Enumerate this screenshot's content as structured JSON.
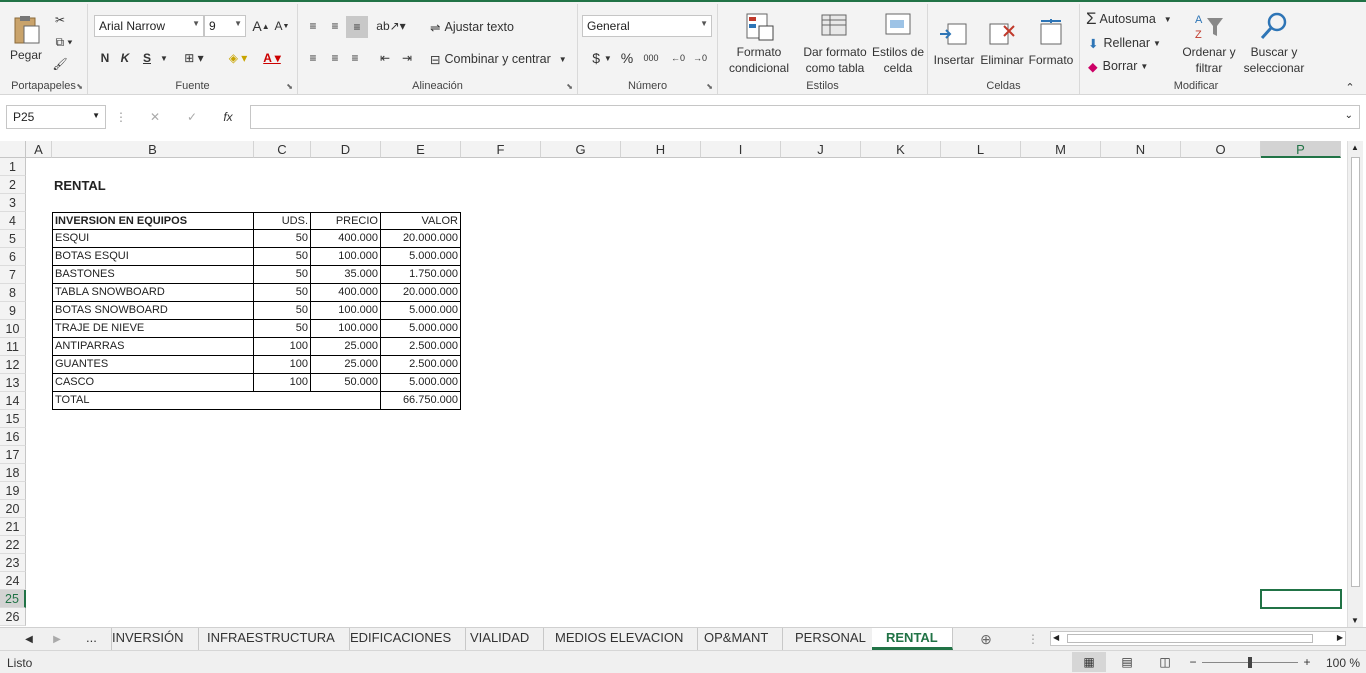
{
  "ribbon": {
    "portapapeles": {
      "label": "Portapapeles",
      "pegar": "Pegar"
    },
    "fuente": {
      "label": "Fuente",
      "font": "Arial Narrow",
      "size": "9",
      "bold": "N",
      "italic": "K",
      "underline": "S"
    },
    "alineacion": {
      "label": "Alineación",
      "wrap": "Ajustar texto",
      "merge": "Combinar y centrar"
    },
    "numero": {
      "label": "Número",
      "format": "General",
      "currency": "$",
      "percent": "%",
      "thousands": "000"
    },
    "estilos": {
      "label": "Estilos",
      "cond": "Formato condicional",
      "table": "Dar formato como tabla",
      "cellstyles": "Estilos de celda"
    },
    "celdas": {
      "label": "Celdas",
      "insert": "Insertar",
      "delete": "Eliminar",
      "format": "Formato"
    },
    "modificar": {
      "label": "Modificar",
      "autosum": "Autosuma",
      "fill": "Rellenar",
      "clear": "Borrar",
      "sort": "Ordenar y filtrar",
      "find": "Buscar y seleccionar"
    }
  },
  "formula_bar": {
    "name_box": "P25",
    "fx": "fx",
    "value": ""
  },
  "columns": [
    "A",
    "B",
    "C",
    "D",
    "E",
    "F",
    "G",
    "H",
    "I",
    "J",
    "K",
    "L",
    "M",
    "N",
    "O",
    "P"
  ],
  "rows": [
    "1",
    "2",
    "3",
    "4",
    "5",
    "6",
    "7",
    "8",
    "9",
    "10",
    "11",
    "12",
    "13",
    "14",
    "15",
    "16",
    "17",
    "18",
    "19",
    "20",
    "21",
    "22",
    "23",
    "24",
    "25",
    "26"
  ],
  "sheet": {
    "title": "RENTAL",
    "headers": [
      "INVERSION EN EQUIPOS",
      "UDS.",
      "PRECIO",
      "VALOR"
    ],
    "items": [
      [
        "ESQUI",
        "50",
        "400.000",
        "20.000.000"
      ],
      [
        "BOTAS ESQUI",
        "50",
        "100.000",
        "5.000.000"
      ],
      [
        "BASTONES",
        "50",
        "35.000",
        "1.750.000"
      ],
      [
        "TABLA SNOWBOARD",
        "50",
        "400.000",
        "20.000.000"
      ],
      [
        "BOTAS SNOWBOARD",
        "50",
        "100.000",
        "5.000.000"
      ],
      [
        "TRAJE DE NIEVE",
        "50",
        "100.000",
        "5.000.000"
      ],
      [
        "ANTIPARRAS",
        "100",
        "25.000",
        "2.500.000"
      ],
      [
        "GUANTES",
        "100",
        "25.000",
        "2.500.000"
      ],
      [
        "CASCO",
        "100",
        "50.000",
        "5.000.000"
      ]
    ],
    "total_label": "TOTAL",
    "total_value": "66.750.000"
  },
  "tabs": [
    "...",
    "INVERSIÓN",
    "INFRAESTRUCTURA",
    "EDIFICACIONES",
    "VIALIDAD",
    "MEDIOS ELEVACION",
    "OP&MANT",
    "PERSONAL",
    "RENTAL"
  ],
  "active_tab": "RENTAL",
  "status": {
    "text": "Listo",
    "zoom": "100 %"
  },
  "colors": {
    "accent": "#217346"
  }
}
